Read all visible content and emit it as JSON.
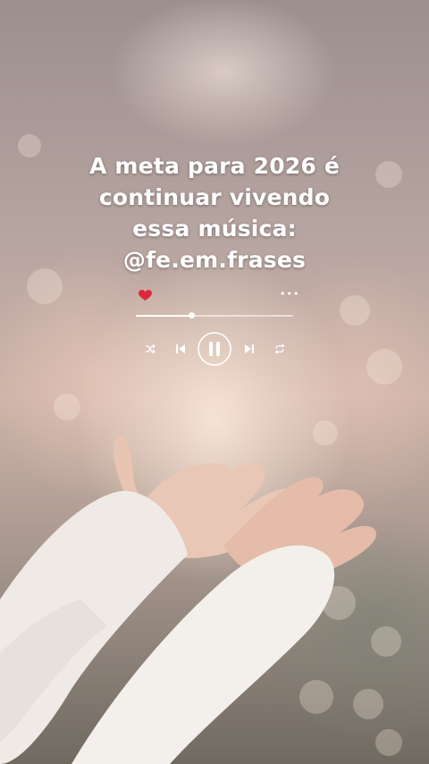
{
  "caption": {
    "lines": [
      "A meta para 2026 é",
      "continuar vivendo",
      "essa música:",
      "@fe.em.frases"
    ]
  },
  "player": {
    "liked": true,
    "heart_color": "#e0263b",
    "progress": 0.35,
    "icons": [
      "heart-icon",
      "more-icon",
      "shuffle-icon",
      "previous-icon",
      "pause-icon",
      "next-icon",
      "repeat-icon"
    ]
  }
}
